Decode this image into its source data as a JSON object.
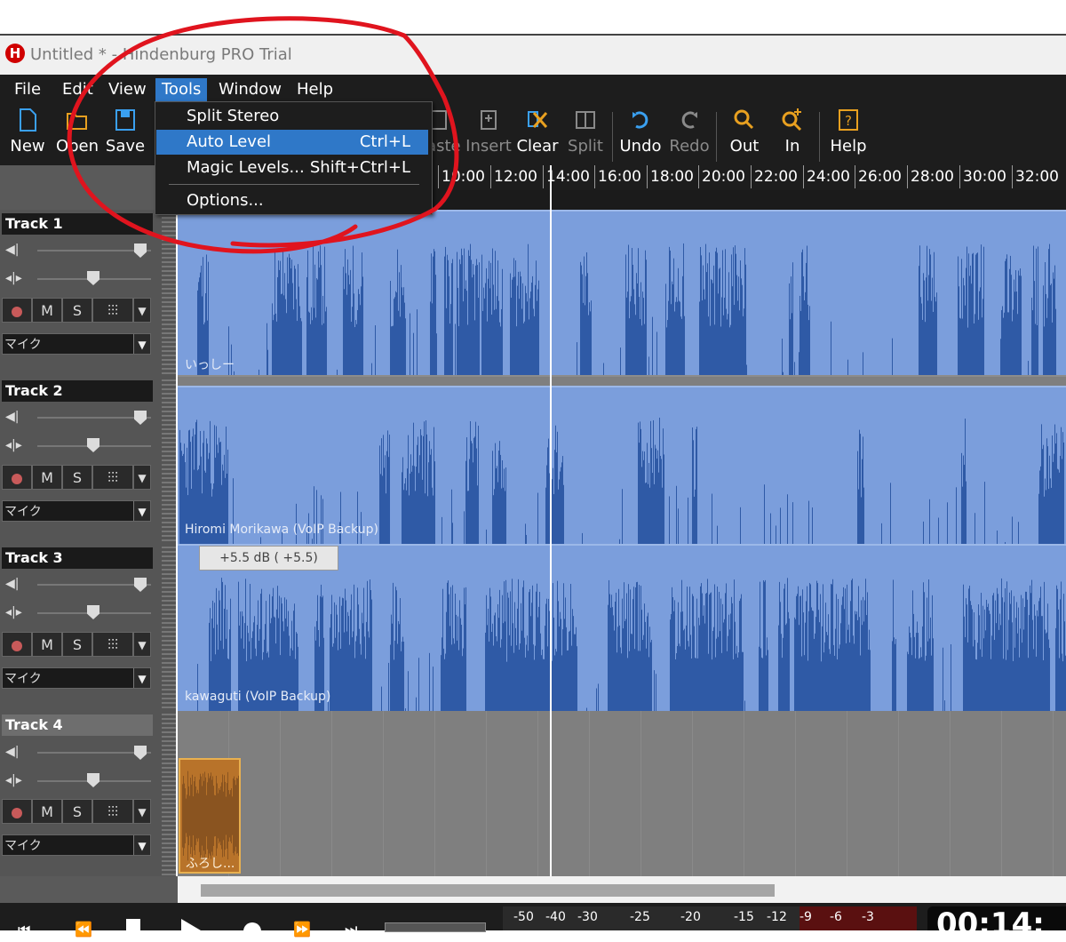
{
  "window": {
    "title": "Untitled * - Hindenburg PRO Trial",
    "logo_letter": "H"
  },
  "menu": [
    "File",
    "Edit",
    "View",
    "Tools",
    "Window",
    "Help"
  ],
  "active_menu": "Tools",
  "tools_menu": {
    "items": [
      {
        "label": "Split Stereo",
        "shortcut": ""
      },
      {
        "label": "Auto Level",
        "shortcut": "Ctrl+L"
      },
      {
        "label": "Magic Levels...",
        "shortcut": "Shift+Ctrl+L"
      },
      {
        "label": "Options...",
        "shortcut": ""
      }
    ],
    "highlighted": "Auto Level"
  },
  "toolbar": {
    "new": "New",
    "open": "Open",
    "save": "Save",
    "paste": "Paste",
    "insert": "Insert",
    "clear": "Clear",
    "split": "Split",
    "undo": "Undo",
    "redo": "Redo",
    "zoom_out": "Out",
    "zoom_in": "In",
    "help": "Help"
  },
  "ruler": [
    "10:00",
    "12:00",
    "14:00",
    "16:00",
    "18:00",
    "20:00",
    "22:00",
    "24:00",
    "26:00",
    "28:00",
    "30:00",
    "32:00"
  ],
  "tracks": [
    {
      "name": "Track 1",
      "input": "マイク",
      "clip_label": "いっしー"
    },
    {
      "name": "Track 2",
      "input": "マイク",
      "clip_label": "Hiromi Morikawa (VoIP Backup)"
    },
    {
      "name": "Track 3",
      "input": "マイク",
      "clip_label": "kawaguti (VoIP Backup)"
    },
    {
      "name": "Track 4",
      "input": "マイク",
      "clip_label": "ふろし..."
    }
  ],
  "track_buttons": {
    "mute": "M",
    "solo": "S",
    "fx": "⫶⫶⫶",
    "dropdown": "▼"
  },
  "gain_tooltip": "+5.5  dB  (  +5.5)",
  "meter_scale": [
    "-50",
    "-40",
    "-30",
    "-25",
    "-20",
    "-15",
    "-12",
    "-9",
    "-6",
    "-3"
  ],
  "timecode_partial": "00:14:",
  "colors": {
    "accent": "#2f78c8",
    "clip": "#7b9edc",
    "waveform": "#2f5aa6",
    "annotation": "#e0141e",
    "track4_clip": "#b8732a"
  }
}
